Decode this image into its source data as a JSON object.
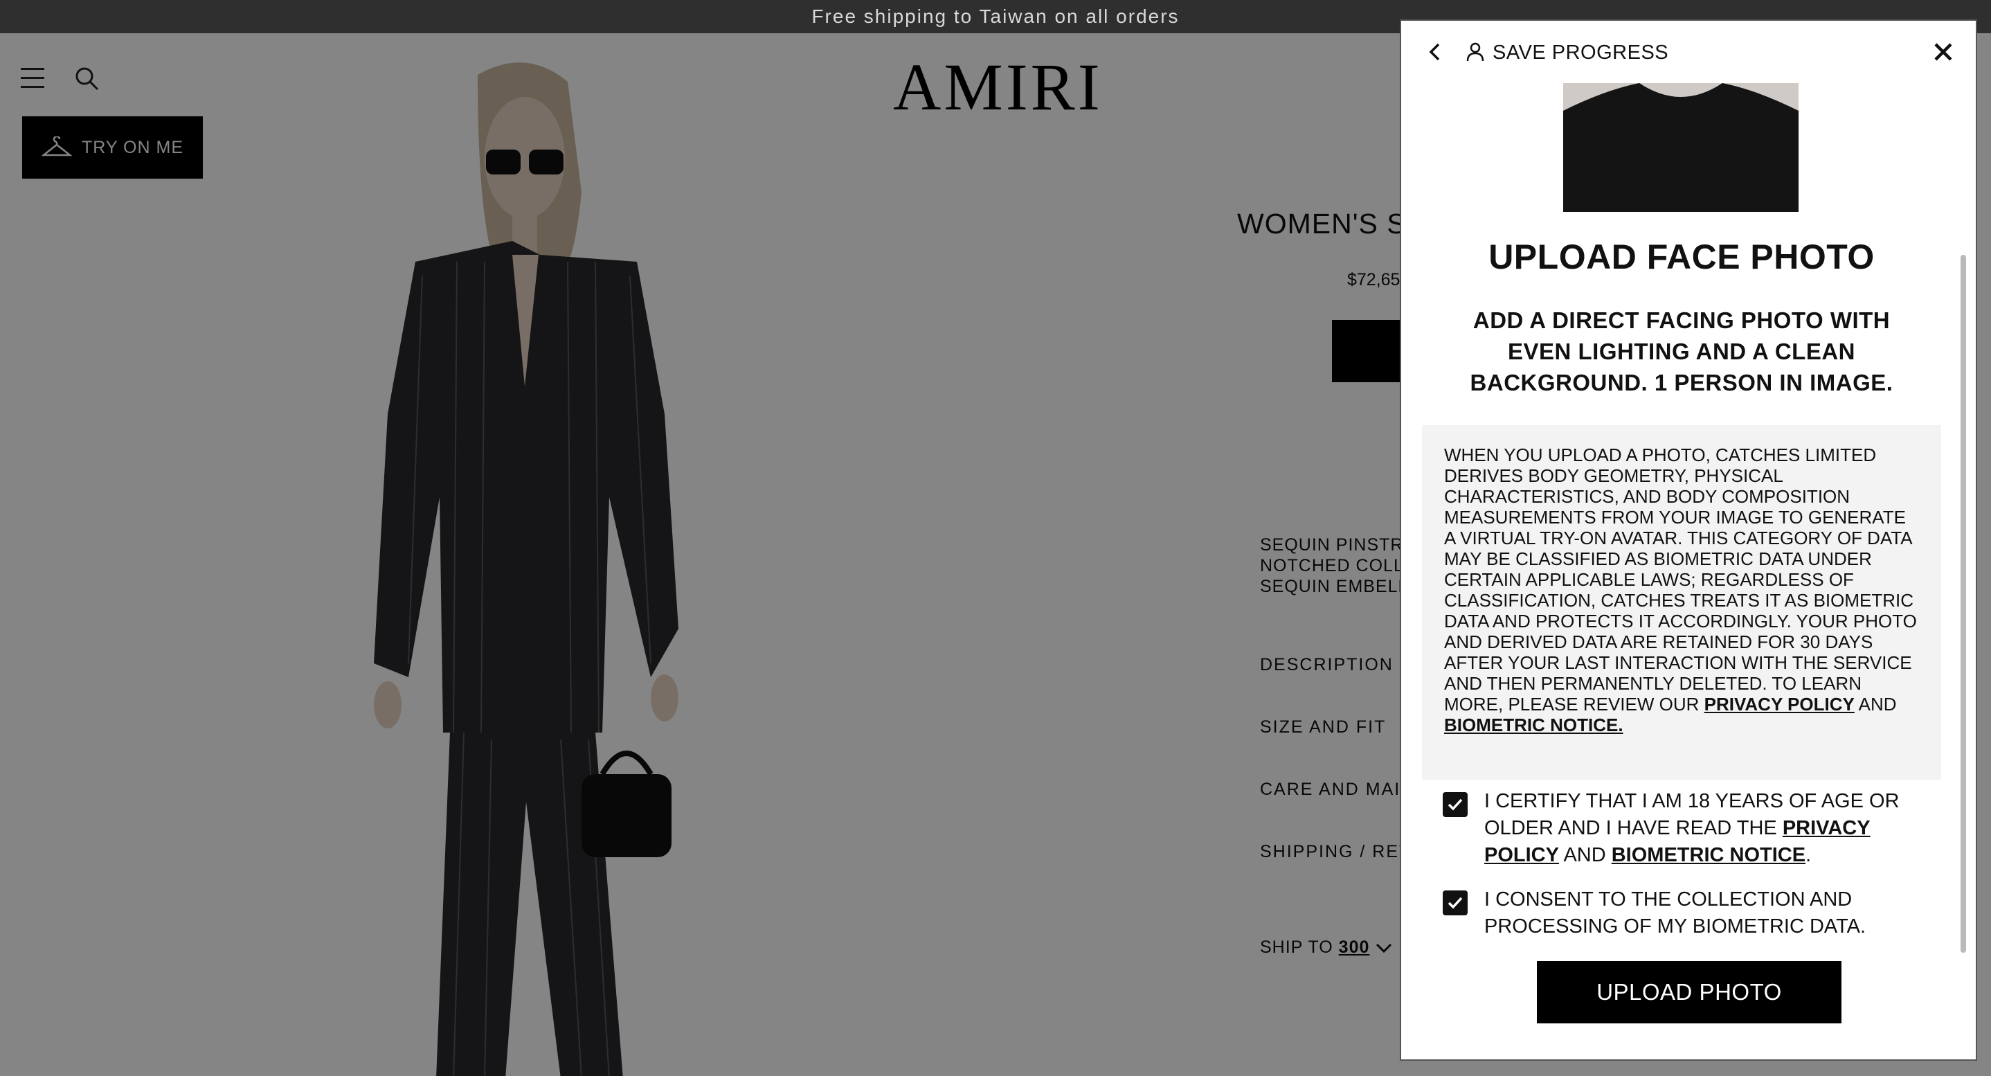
{
  "announcement": "Free shipping to Taiwan on all orders",
  "header": {
    "logo": "AMIRI",
    "try_on_label": "TRY ON ME"
  },
  "product": {
    "title_visible": "WOMEN'S S",
    "price_visible": "$72,65",
    "bullets": [
      "SEQUIN PINSTR",
      "NOTCHED COLL",
      "SEQUIN EMBELL"
    ],
    "accordion": [
      "DESCRIPTION",
      "SIZE AND FIT",
      "CARE AND MAIN",
      "SHIPPING / RET"
    ],
    "ship_to_label": "SHIP TO",
    "ship_to_value": "300"
  },
  "modal": {
    "save_label": "SAVE PROGRESS",
    "title": "UPLOAD FACE PHOTO",
    "subtitle": "ADD A DIRECT FACING PHOTO WITH EVEN LIGHTING AND A CLEAN BACKGROUND. 1 PERSON IN IMAGE.",
    "notice_text": "WHEN YOU UPLOAD A PHOTO, CATCHES LIMITED DERIVES BODY GEOMETRY, PHYSICAL CHARACTERISTICS, AND BODY COMPOSITION MEASUREMENTS FROM YOUR IMAGE TO GENERATE A VIRTUAL TRY-ON AVATAR. THIS CATEGORY OF DATA MAY BE CLASSIFIED AS BIOMETRIC DATA UNDER CERTAIN APPLICABLE LAWS; REGARDLESS OF CLASSIFICATION, CATCHES TREATS IT AS BIOMETRIC DATA AND PROTECTS IT ACCORDINGLY. YOUR PHOTO AND DERIVED DATA ARE RETAINED FOR 30 DAYS AFTER YOUR LAST INTERACTION WITH THE SERVICE AND THEN PERMANENTLY DELETED. TO LEARN MORE, PLEASE REVIEW OUR",
    "privacy_policy_link": "PRIVACY POLICY",
    "and_word": "AND",
    "biometric_notice_link_period": "BIOMETRIC NOTICE.",
    "certify": {
      "checked": true,
      "text_before": "I CERTIFY THAT I AM 18 YEARS OF AGE OR OLDER AND I HAVE READ THE",
      "privacy_link": "PRIVACY POLICY",
      "and_word": "AND",
      "biometric_link": "BIOMETRIC NOTICE",
      "period": "."
    },
    "consent": {
      "checked": true,
      "text": "I CONSENT TO THE COLLECTION AND PROCESSING OF MY BIOMETRIC DATA."
    },
    "upload_button": "UPLOAD PHOTO"
  },
  "colors": {
    "topbar": "#2f2f2f",
    "overlay": "rgba(0,0,0,0.48)",
    "button": "#000000",
    "notice_bg": "#f3f3f3"
  }
}
